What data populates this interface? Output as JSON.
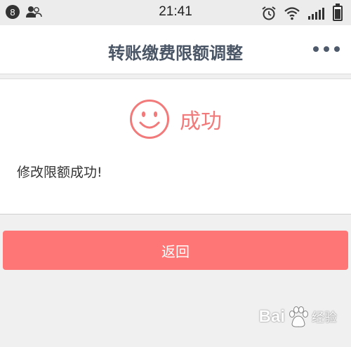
{
  "status_bar": {
    "notification_count": "8",
    "time": "21:41"
  },
  "nav": {
    "title": "转账缴费限额调整",
    "more_icon": "more-dots-icon"
  },
  "result": {
    "icon": "smile-icon",
    "title": "成功",
    "message": "修改限额成功!"
  },
  "actions": {
    "back_label": "返回"
  },
  "watermark": {
    "brand": "Bai",
    "suffix": "经验"
  },
  "colors": {
    "accent": "#f27a7a",
    "button": "#ff7676",
    "nav_text": "#4a5565"
  }
}
